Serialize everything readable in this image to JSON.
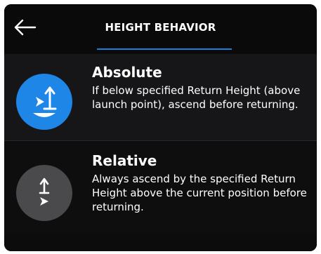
{
  "header": {
    "title": "HEIGHT BEHAVIOR",
    "back_icon": "arrow-left-icon"
  },
  "options": [
    {
      "title": "Absolute",
      "description": "If below specified Return Height (above launch point), ascend before returning.",
      "icon": "absolute-height-icon",
      "icon_color": "#1e86e6",
      "selected": true
    },
    {
      "title": "Relative",
      "description": "Always ascend by the specified Return Height above the current position before returning.",
      "icon": "relative-height-icon",
      "icon_color": "#4a4a4c",
      "selected": false
    }
  ],
  "colors": {
    "accent": "#1c7fe0",
    "background": "#0c0c0d"
  }
}
